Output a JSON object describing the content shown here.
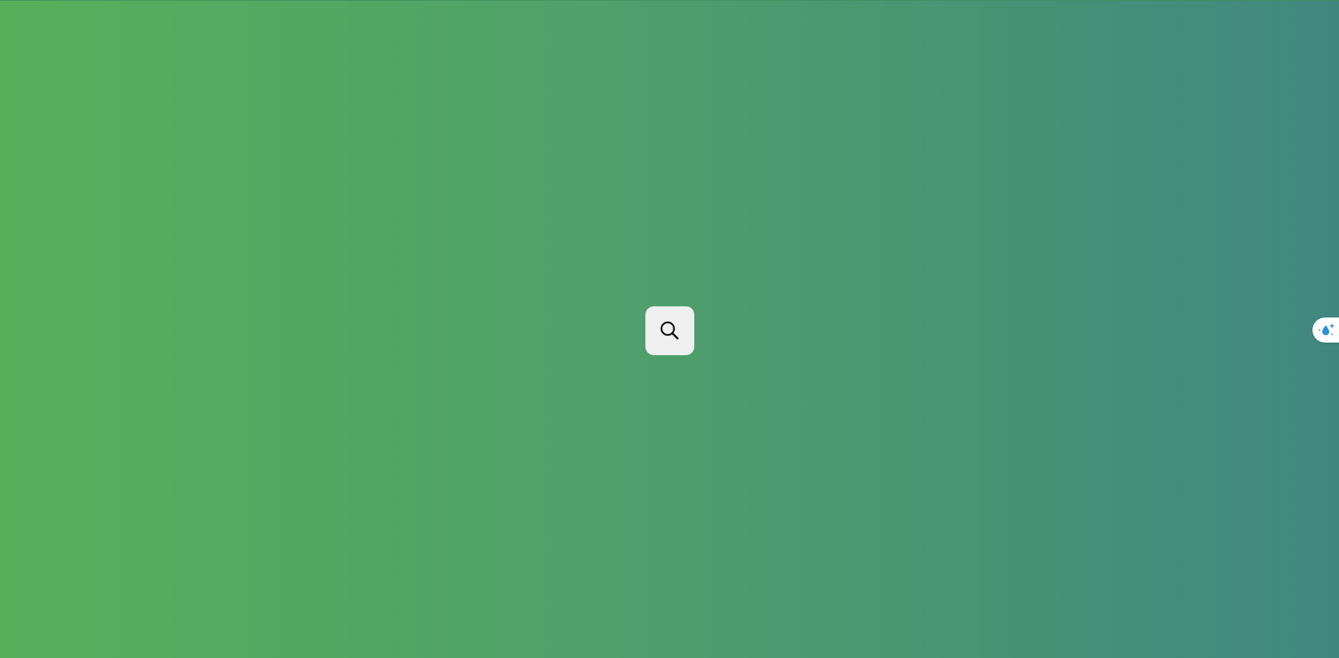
{
  "page": {
    "background_colors": [
      "#56b05a",
      "#4e9e6c",
      "#41877f"
    ]
  },
  "search_button": {
    "icon": "search-icon",
    "bg_color": "#efefef",
    "icon_color": "#111111"
  },
  "side_tab": {
    "icon": "sparkle-droplet-icon",
    "bg_color": "#ffffff",
    "icon_color": "#2f8fd8"
  }
}
